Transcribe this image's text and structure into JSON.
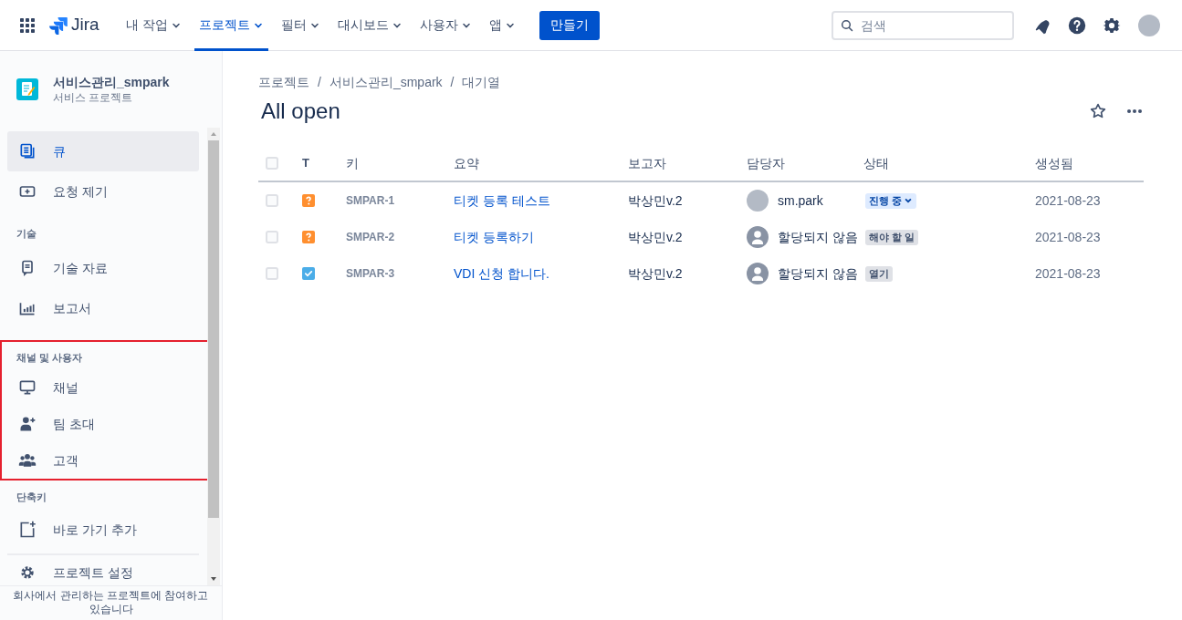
{
  "top_nav": {
    "logo": "Jira",
    "menu": [
      {
        "label": "내 작업",
        "selected": false
      },
      {
        "label": "프로젝트",
        "selected": true
      },
      {
        "label": "필터",
        "selected": false
      },
      {
        "label": "대시보드",
        "selected": false
      },
      {
        "label": "사용자",
        "selected": false
      },
      {
        "label": "앱",
        "selected": false
      }
    ],
    "create_button": "만들기",
    "search": {
      "placeholder": "검색"
    }
  },
  "sidebar": {
    "project": {
      "name": "서비스관리_smpark",
      "type": "서비스 프로젝트"
    },
    "sections": [
      {
        "items": [
          {
            "label": "큐",
            "kind": "queue",
            "selected": true
          },
          {
            "label": "요청 제기",
            "kind": "raise",
            "selected": false
          }
        ]
      },
      {
        "heading": "기술",
        "items": [
          {
            "label": "기술 자료",
            "kind": "knowledge",
            "selected": false
          },
          {
            "label": "보고서",
            "kind": "reports",
            "selected": false
          }
        ]
      },
      {
        "heading": "채널 및 사용자",
        "highlighted": true,
        "items": [
          {
            "label": "채널",
            "kind": "monitor",
            "selected": false
          },
          {
            "label": "팀 초대",
            "kind": "invite",
            "selected": false
          },
          {
            "label": "고객",
            "kind": "people",
            "selected": false
          }
        ]
      },
      {
        "heading": "단축키",
        "items": [
          {
            "label": "바로 가기 추가",
            "kind": "shortcut",
            "selected": false
          }
        ]
      },
      {
        "divider": true,
        "items": [
          {
            "label": "프로젝트 설정",
            "kind": "gear",
            "selected": false
          }
        ]
      }
    ],
    "footer": "회사에서 관리하는 프로젝트에 참여하고 있습니다"
  },
  "breadcrumbs": {
    "separator": "/",
    "items": [
      "프로젝트",
      "서비스관리_smpark",
      "대기열"
    ]
  },
  "title": "All open",
  "table": {
    "select_all": {
      "checked": false
    },
    "columns": [
      "T",
      "키",
      "요약",
      "보고자",
      "담당자",
      "상태",
      "생성됨"
    ],
    "rows": [
      {
        "selected": false,
        "kind": "question",
        "key": "SMPAR-1",
        "summary": "티켓 등록 테스트",
        "reporter": "박상민v.2",
        "assignee": {
          "name": "sm.park",
          "kind": "photo"
        },
        "status": {
          "label": "진행 중",
          "kind": "active",
          "dropdown": true
        },
        "created": "2021-08-23"
      },
      {
        "selected": false,
        "kind": "question",
        "key": "SMPAR-2",
        "summary": "티켓 등록하기",
        "reporter": "박상민v.2",
        "assignee": {
          "name": "할당되지 않음",
          "kind": "default"
        },
        "status": {
          "label": "해야 할 일",
          "kind": "neutral"
        },
        "created": "2021-08-23"
      },
      {
        "selected": false,
        "kind": "task",
        "key": "SMPAR-3",
        "summary": "VDI 신청 합니다.",
        "reporter": "박상민v.2",
        "assignee": {
          "name": "할당되지 않음",
          "kind": "default"
        },
        "status": {
          "label": "열기",
          "kind": "neutral"
        },
        "created": "2021-08-23"
      }
    ]
  }
}
